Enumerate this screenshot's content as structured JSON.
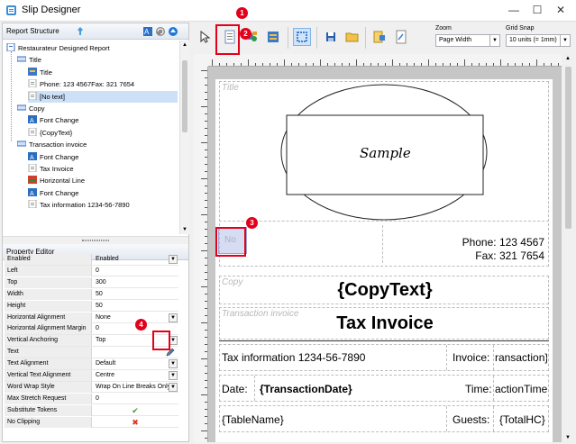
{
  "window": {
    "title": "Slip Designer"
  },
  "structure": {
    "header": "Report Structure",
    "nodes": [
      {
        "label": "Restaurateur Designed Report",
        "level": 0,
        "icon": "report-icon"
      },
      {
        "label": "Title",
        "level": 1,
        "icon": "section-icon"
      },
      {
        "label": "Title",
        "level": 2,
        "icon": "image-icon"
      },
      {
        "label": "Phone: 123 4567Fax: 321 7654",
        "level": 2,
        "icon": "text-icon"
      },
      {
        "label": "[No text]",
        "level": 2,
        "icon": "text-icon",
        "selected": true
      },
      {
        "label": "Copy",
        "level": 1,
        "icon": "section-icon"
      },
      {
        "label": "Font Change",
        "level": 2,
        "icon": "font-icon"
      },
      {
        "label": "{CopyText}",
        "level": 2,
        "icon": "text-icon"
      },
      {
        "label": "Transaction invoice",
        "level": 1,
        "icon": "section-icon"
      },
      {
        "label": "Font Change",
        "level": 2,
        "icon": "font-icon"
      },
      {
        "label": "Tax Invoice",
        "level": 2,
        "icon": "text-icon"
      },
      {
        "label": "Horizontal Line",
        "level": 2,
        "icon": "line-icon"
      },
      {
        "label": "Font Change",
        "level": 2,
        "icon": "font-icon"
      },
      {
        "label": "Tax information 1234-56-7890",
        "level": 2,
        "icon": "text-icon"
      }
    ]
  },
  "property_editor": {
    "header": "Property Editor",
    "rows": [
      {
        "key": "Enabled",
        "value": "Enabled",
        "dropdown": true
      },
      {
        "key": "Left",
        "value": "0"
      },
      {
        "key": "Top",
        "value": "300"
      },
      {
        "key": "Width",
        "value": "50"
      },
      {
        "key": "Height",
        "value": "50"
      },
      {
        "key": "Horizontal Alignment",
        "value": "None",
        "dropdown": true
      },
      {
        "key": "Horizontal Alignment Margin",
        "value": "0"
      },
      {
        "key": "Vertical Anchoring",
        "value": "Top",
        "dropdown": true
      },
      {
        "key": "Text",
        "value": ""
      },
      {
        "key": "Text Alignment",
        "value": "Default",
        "dropdown": true
      },
      {
        "key": "Vertical Text Alignment",
        "value": "Centre",
        "dropdown": true
      },
      {
        "key": "Word Wrap Style",
        "value": "Wrap On Line Breaks Only",
        "dropdown": true
      },
      {
        "key": "Max Stretch Request",
        "value": "0"
      },
      {
        "key": "Substitute Tokens",
        "value": "✔",
        "color": "#3a9a2a"
      },
      {
        "key": "No Clipping",
        "value": "✖",
        "color": "#e03020"
      }
    ]
  },
  "toolbar": {
    "zoom_label": "Zoom",
    "zoom_value": "Page Width",
    "grid_label": "Grid Snap",
    "grid_value": "10 units (= 1mm)"
  },
  "slip": {
    "title_section": "Title",
    "sample_text": "Sample",
    "no_text": "No",
    "phone": "Phone: 123 4567",
    "fax": "Fax: 321 7654",
    "copy_section": "Copy",
    "copy_text": "{CopyText}",
    "transaction_section": "Transaction invoice",
    "tax_invoice": "Tax Invoice",
    "tax_info": "Tax information 1234-56-7890",
    "invoice_label": "Invoice:",
    "invoice_value": "ransaction}",
    "date_label": "Date:",
    "date_value": "{TransactionDate}",
    "time_label": "Time:",
    "time_value": "actionTime}",
    "table_name": "{TableName}",
    "guests_label": "Guests:",
    "guests_value": "{TotalHC}"
  },
  "annotations": [
    "1",
    "2",
    "3",
    "4"
  ],
  "colors": {
    "accent_red": "#e3001b",
    "selection": "#cce0f7"
  }
}
